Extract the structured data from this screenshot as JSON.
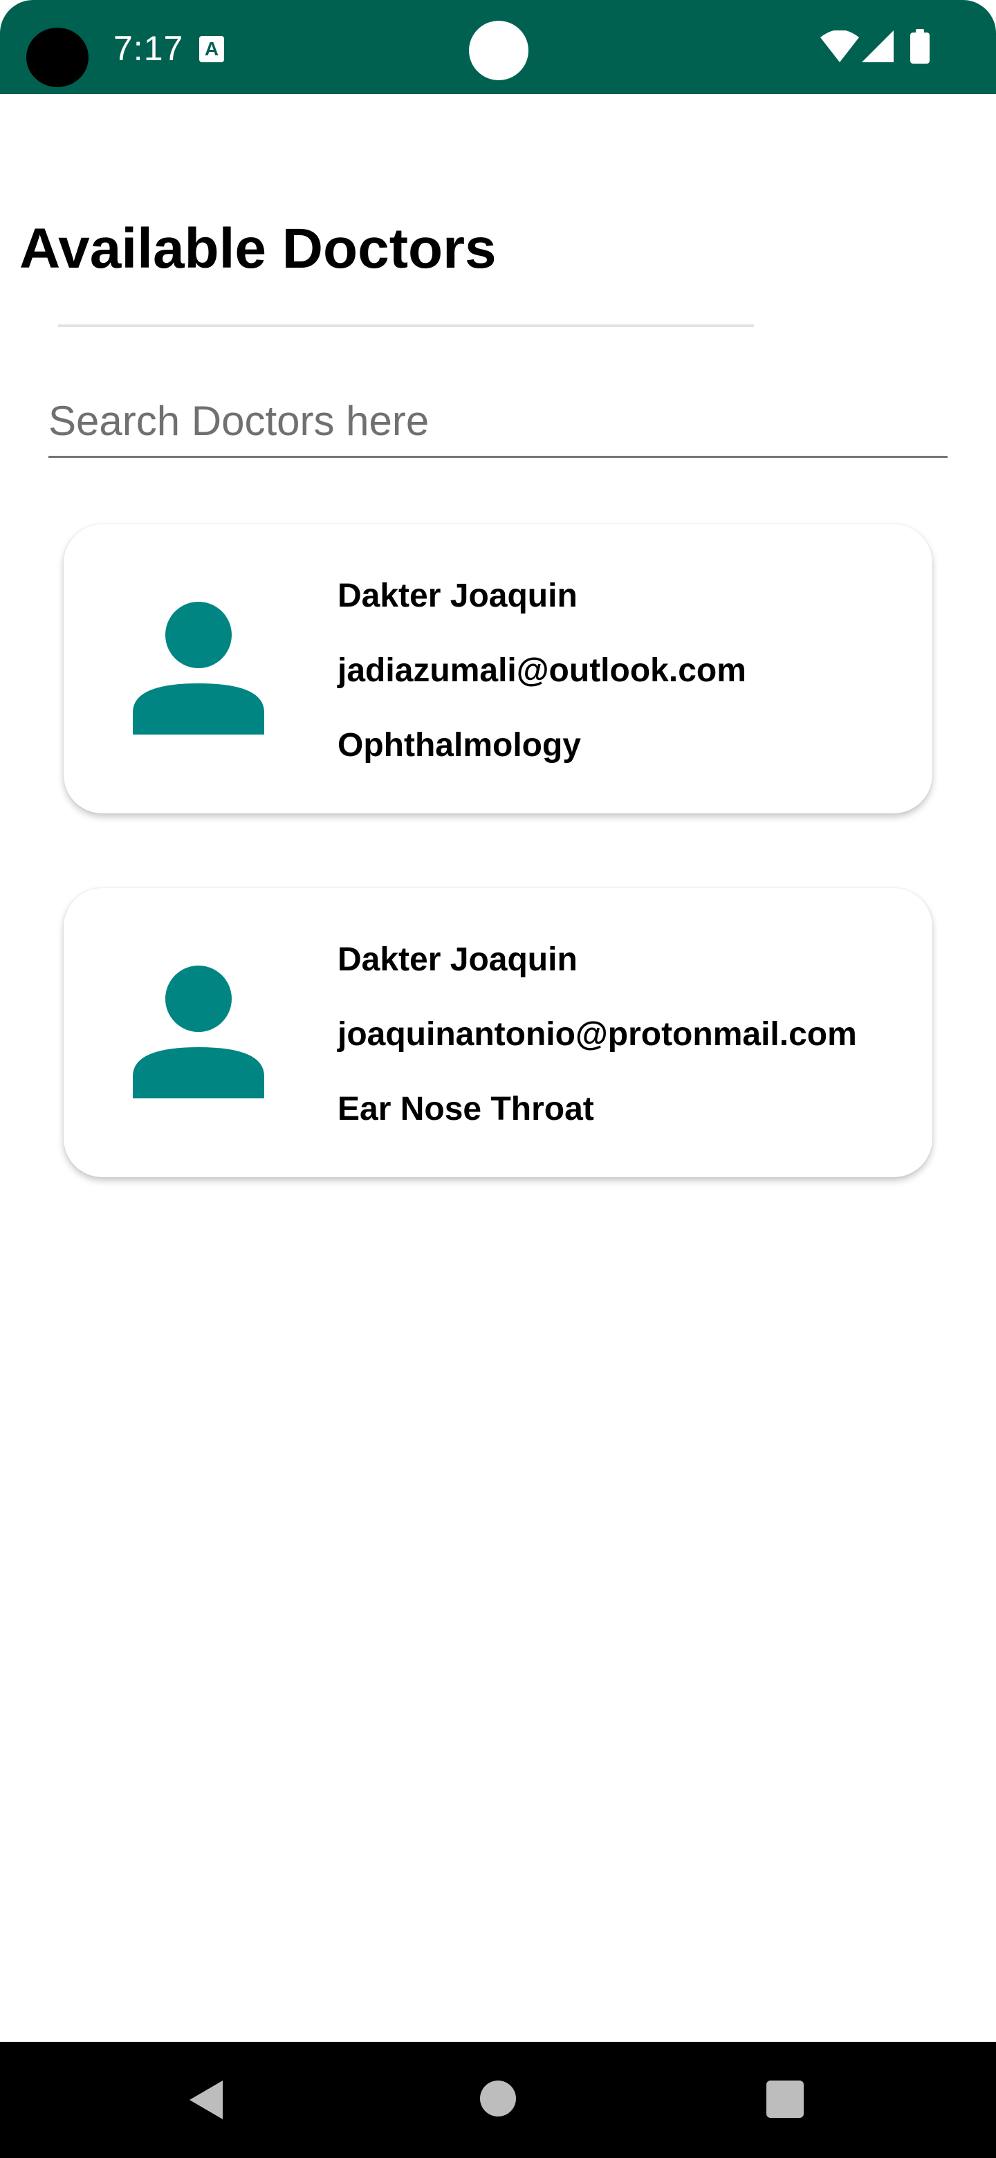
{
  "status_bar": {
    "time": "7:17",
    "notification_icon": "A",
    "icons": [
      "wifi-icon",
      "cellular-signal-icon",
      "battery-icon"
    ],
    "background_color": "#006151"
  },
  "header": {
    "title": "Available Doctors"
  },
  "search": {
    "placeholder": "Search Doctors here",
    "value": ""
  },
  "doctors": [
    {
      "name": "Dakter Joaquin",
      "email": "jadiazumali@outlook.com",
      "specialty": "Ophthalmology",
      "avatar_icon": "person-icon"
    },
    {
      "name": "Dakter Joaquin",
      "email": "joaquinantonio@protonmail.com",
      "specialty": "Ear Nose Throat",
      "avatar_icon": "person-icon"
    }
  ],
  "nav_bar": {
    "icons": [
      "back-icon",
      "home-icon",
      "recents-icon"
    ]
  },
  "colors": {
    "accent": "#008582",
    "status_bar": "#006151",
    "nav_bar": "#000000"
  }
}
